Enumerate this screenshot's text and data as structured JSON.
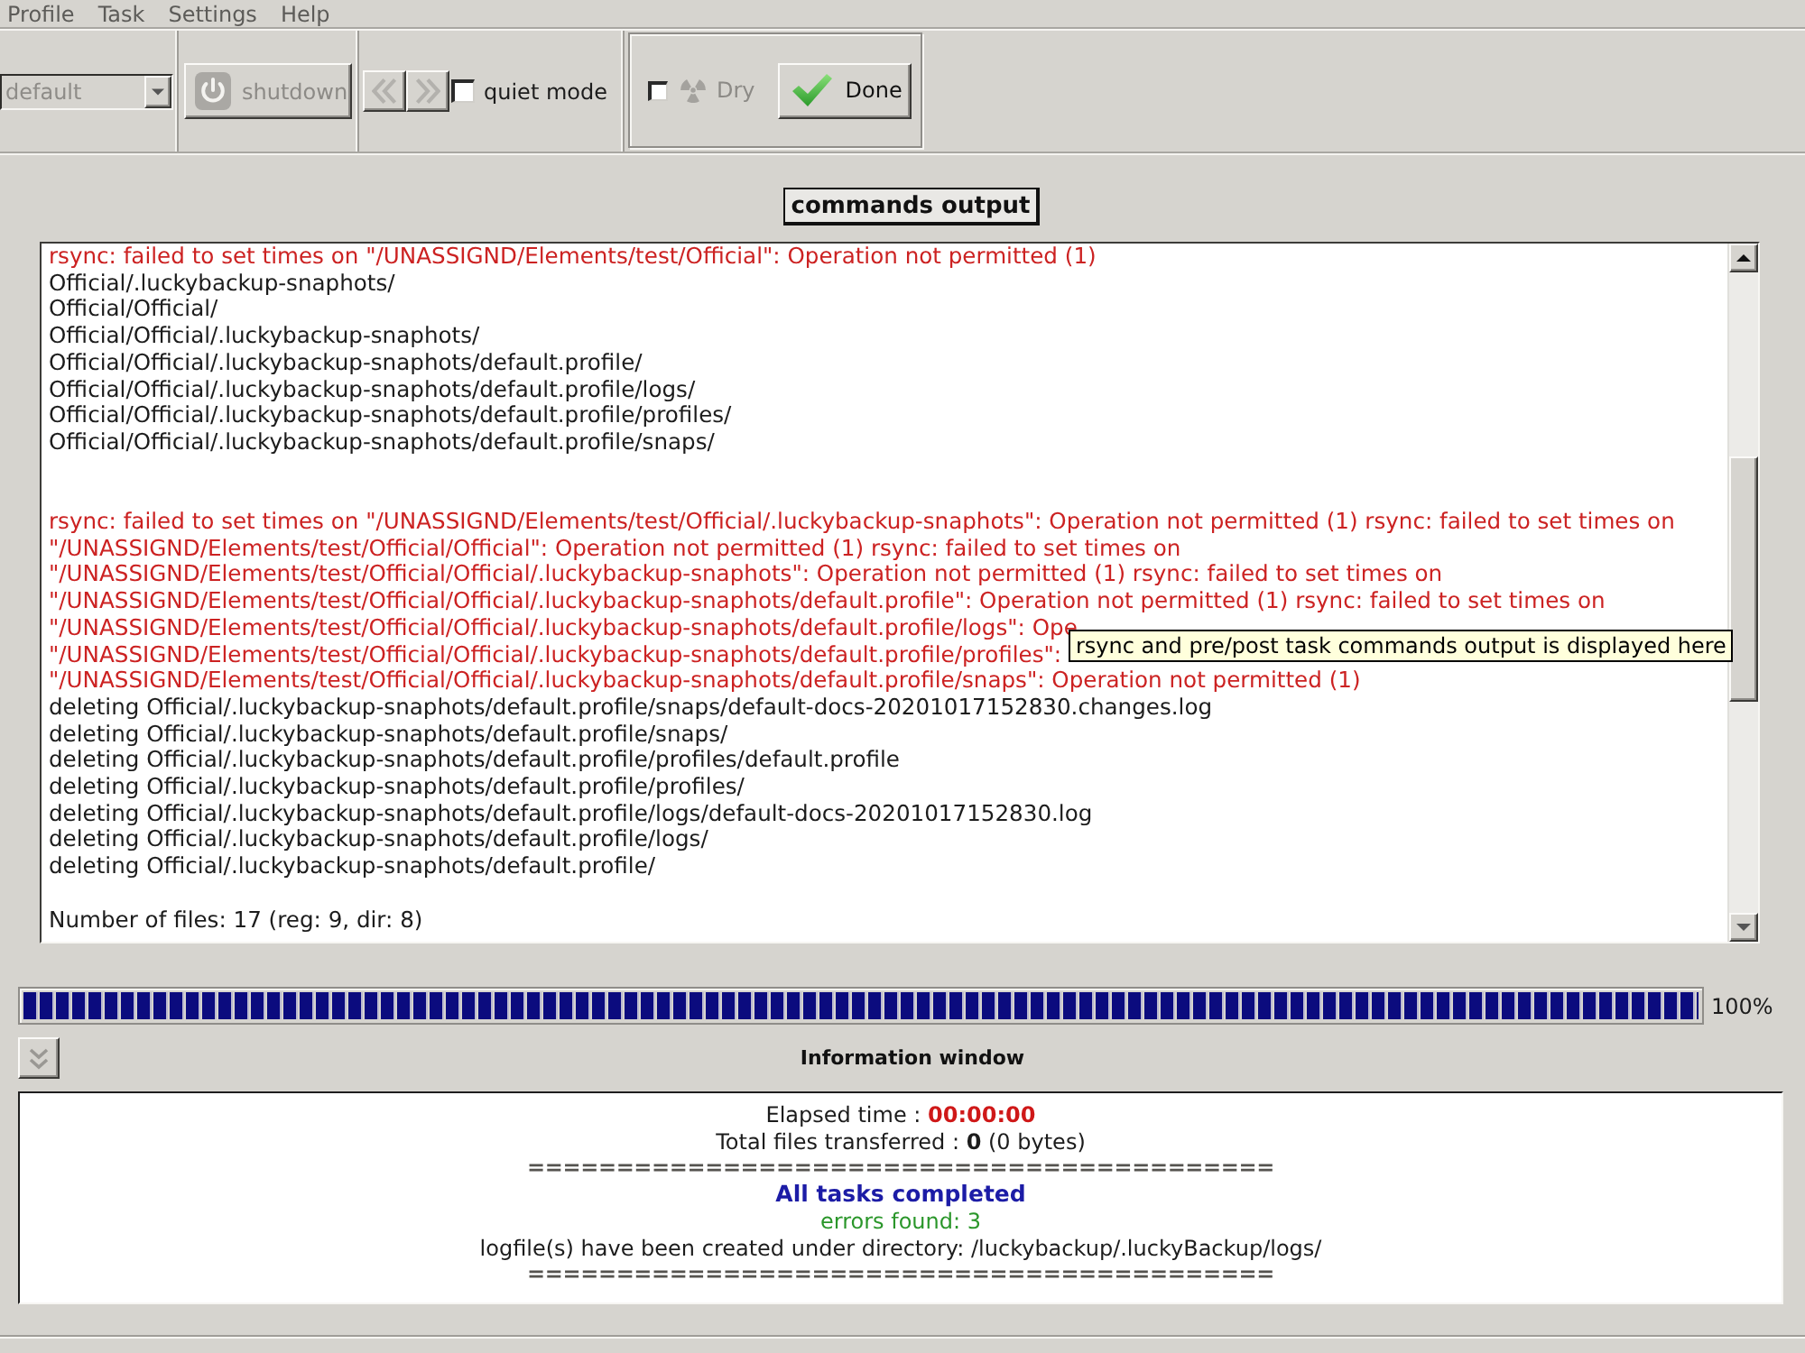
{
  "menu_bar": [
    "Profile",
    "Task",
    "Settings",
    "Help"
  ],
  "toolbar": {
    "profile_combo": {
      "value": "default",
      "disabled": true
    },
    "shutdown_button": {
      "label": "shutdown",
      "disabled": true
    },
    "nav_buttons": [
      {
        "kind": "previous",
        "disabled": true
      },
      {
        "kind": "next",
        "disabled": true
      }
    ],
    "quiet_mode": {
      "label": "quiet mode",
      "checked": false
    },
    "dry_run": {
      "label": "Dry",
      "checked": false,
      "disabled": true
    },
    "done_button": {
      "label": "Done"
    }
  },
  "output_toggle": {
    "label": "commands output"
  },
  "output_log": [
    {
      "kind": "error",
      "text": "rsync: failed to set times on \"/UNASSIGND/Elements/test/Official\": Operation not permitted (1)"
    },
    {
      "kind": "normal",
      "text": "Official/.luckybackup-snaphots/"
    },
    {
      "kind": "normal",
      "text": "Official/Official/"
    },
    {
      "kind": "normal",
      "text": "Official/Official/.luckybackup-snaphots/"
    },
    {
      "kind": "normal",
      "text": "Official/Official/.luckybackup-snaphots/default.profile/"
    },
    {
      "kind": "normal",
      "text": "Official/Official/.luckybackup-snaphots/default.profile/logs/"
    },
    {
      "kind": "normal",
      "text": "Official/Official/.luckybackup-snaphots/default.profile/profiles/"
    },
    {
      "kind": "normal",
      "text": "Official/Official/.luckybackup-snaphots/default.profile/snaps/"
    },
    {
      "kind": "blank"
    },
    {
      "kind": "blank"
    },
    {
      "kind": "error",
      "text": "rsync: failed to set times on \"/UNASSIGND/Elements/test/Official/.luckybackup-snaphots\": Operation not permitted (1) rsync: failed to set times on"
    },
    {
      "kind": "error",
      "text": "\"/UNASSIGND/Elements/test/Official/Official\": Operation not permitted (1) rsync: failed to set times on"
    },
    {
      "kind": "error",
      "text": "\"/UNASSIGND/Elements/test/Official/Official/.luckybackup-snaphots\": Operation not permitted (1) rsync: failed to set times on"
    },
    {
      "kind": "error",
      "text": "\"/UNASSIGND/Elements/test/Official/Official/.luckybackup-snaphots/default.profile\": Operation not permitted (1) rsync: failed to set times on"
    },
    {
      "kind": "error",
      "text": "\"/UNASSIGND/Elements/test/Official/Official/.luckybackup-snaphots/default.profile/logs\": Ope"
    },
    {
      "kind": "error",
      "text": "\"/UNASSIGND/Elements/test/Official/Official/.luckybackup-snaphots/default.profile/profiles\":"
    },
    {
      "kind": "error",
      "text": "\"/UNASSIGND/Elements/test/Official/Official/.luckybackup-snaphots/default.profile/snaps\": Operation not permitted (1)"
    },
    {
      "kind": "normal",
      "text": "deleting Official/.luckybackup-snaphots/default.profile/snaps/default-docs-20201017152830.changes.log"
    },
    {
      "kind": "normal",
      "text": "deleting Official/.luckybackup-snaphots/default.profile/snaps/"
    },
    {
      "kind": "normal",
      "text": "deleting Official/.luckybackup-snaphots/default.profile/profiles/default.profile"
    },
    {
      "kind": "normal",
      "text": "deleting Official/.luckybackup-snaphots/default.profile/profiles/"
    },
    {
      "kind": "normal",
      "text": "deleting Official/.luckybackup-snaphots/default.profile/logs/default-docs-20201017152830.log"
    },
    {
      "kind": "normal",
      "text": "deleting Official/.luckybackup-snaphots/default.profile/logs/"
    },
    {
      "kind": "normal",
      "text": "deleting Official/.luckybackup-snaphots/default.profile/"
    },
    {
      "kind": "blank"
    },
    {
      "kind": "normal",
      "text": "Number of files: 17 (reg: 9, dir: 8)"
    }
  ],
  "tooltip": {
    "text": "rsync and pre/post task commands output is displayed here"
  },
  "progress": {
    "level": 1,
    "reading": "100%"
  },
  "info_window": {
    "title": "Information window",
    "lines": [
      {
        "kind": "elapsed",
        "label": "Elapsed time :",
        "value": "00:00:00"
      },
      {
        "kind": "text",
        "text": "Total files transferred : **0** (0 bytes)"
      },
      {
        "kind": "rule",
        "text": "=========================================="
      },
      {
        "kind": "heading",
        "text": "All tasks completed"
      },
      {
        "kind": "errors",
        "text": "errors found: 3"
      },
      {
        "kind": "text",
        "text": "logfile(s) have been created under directory: /luckybackup/.luckyBackup/logs/"
      },
      {
        "kind": "rule",
        "text": "=========================================="
      }
    ]
  }
}
